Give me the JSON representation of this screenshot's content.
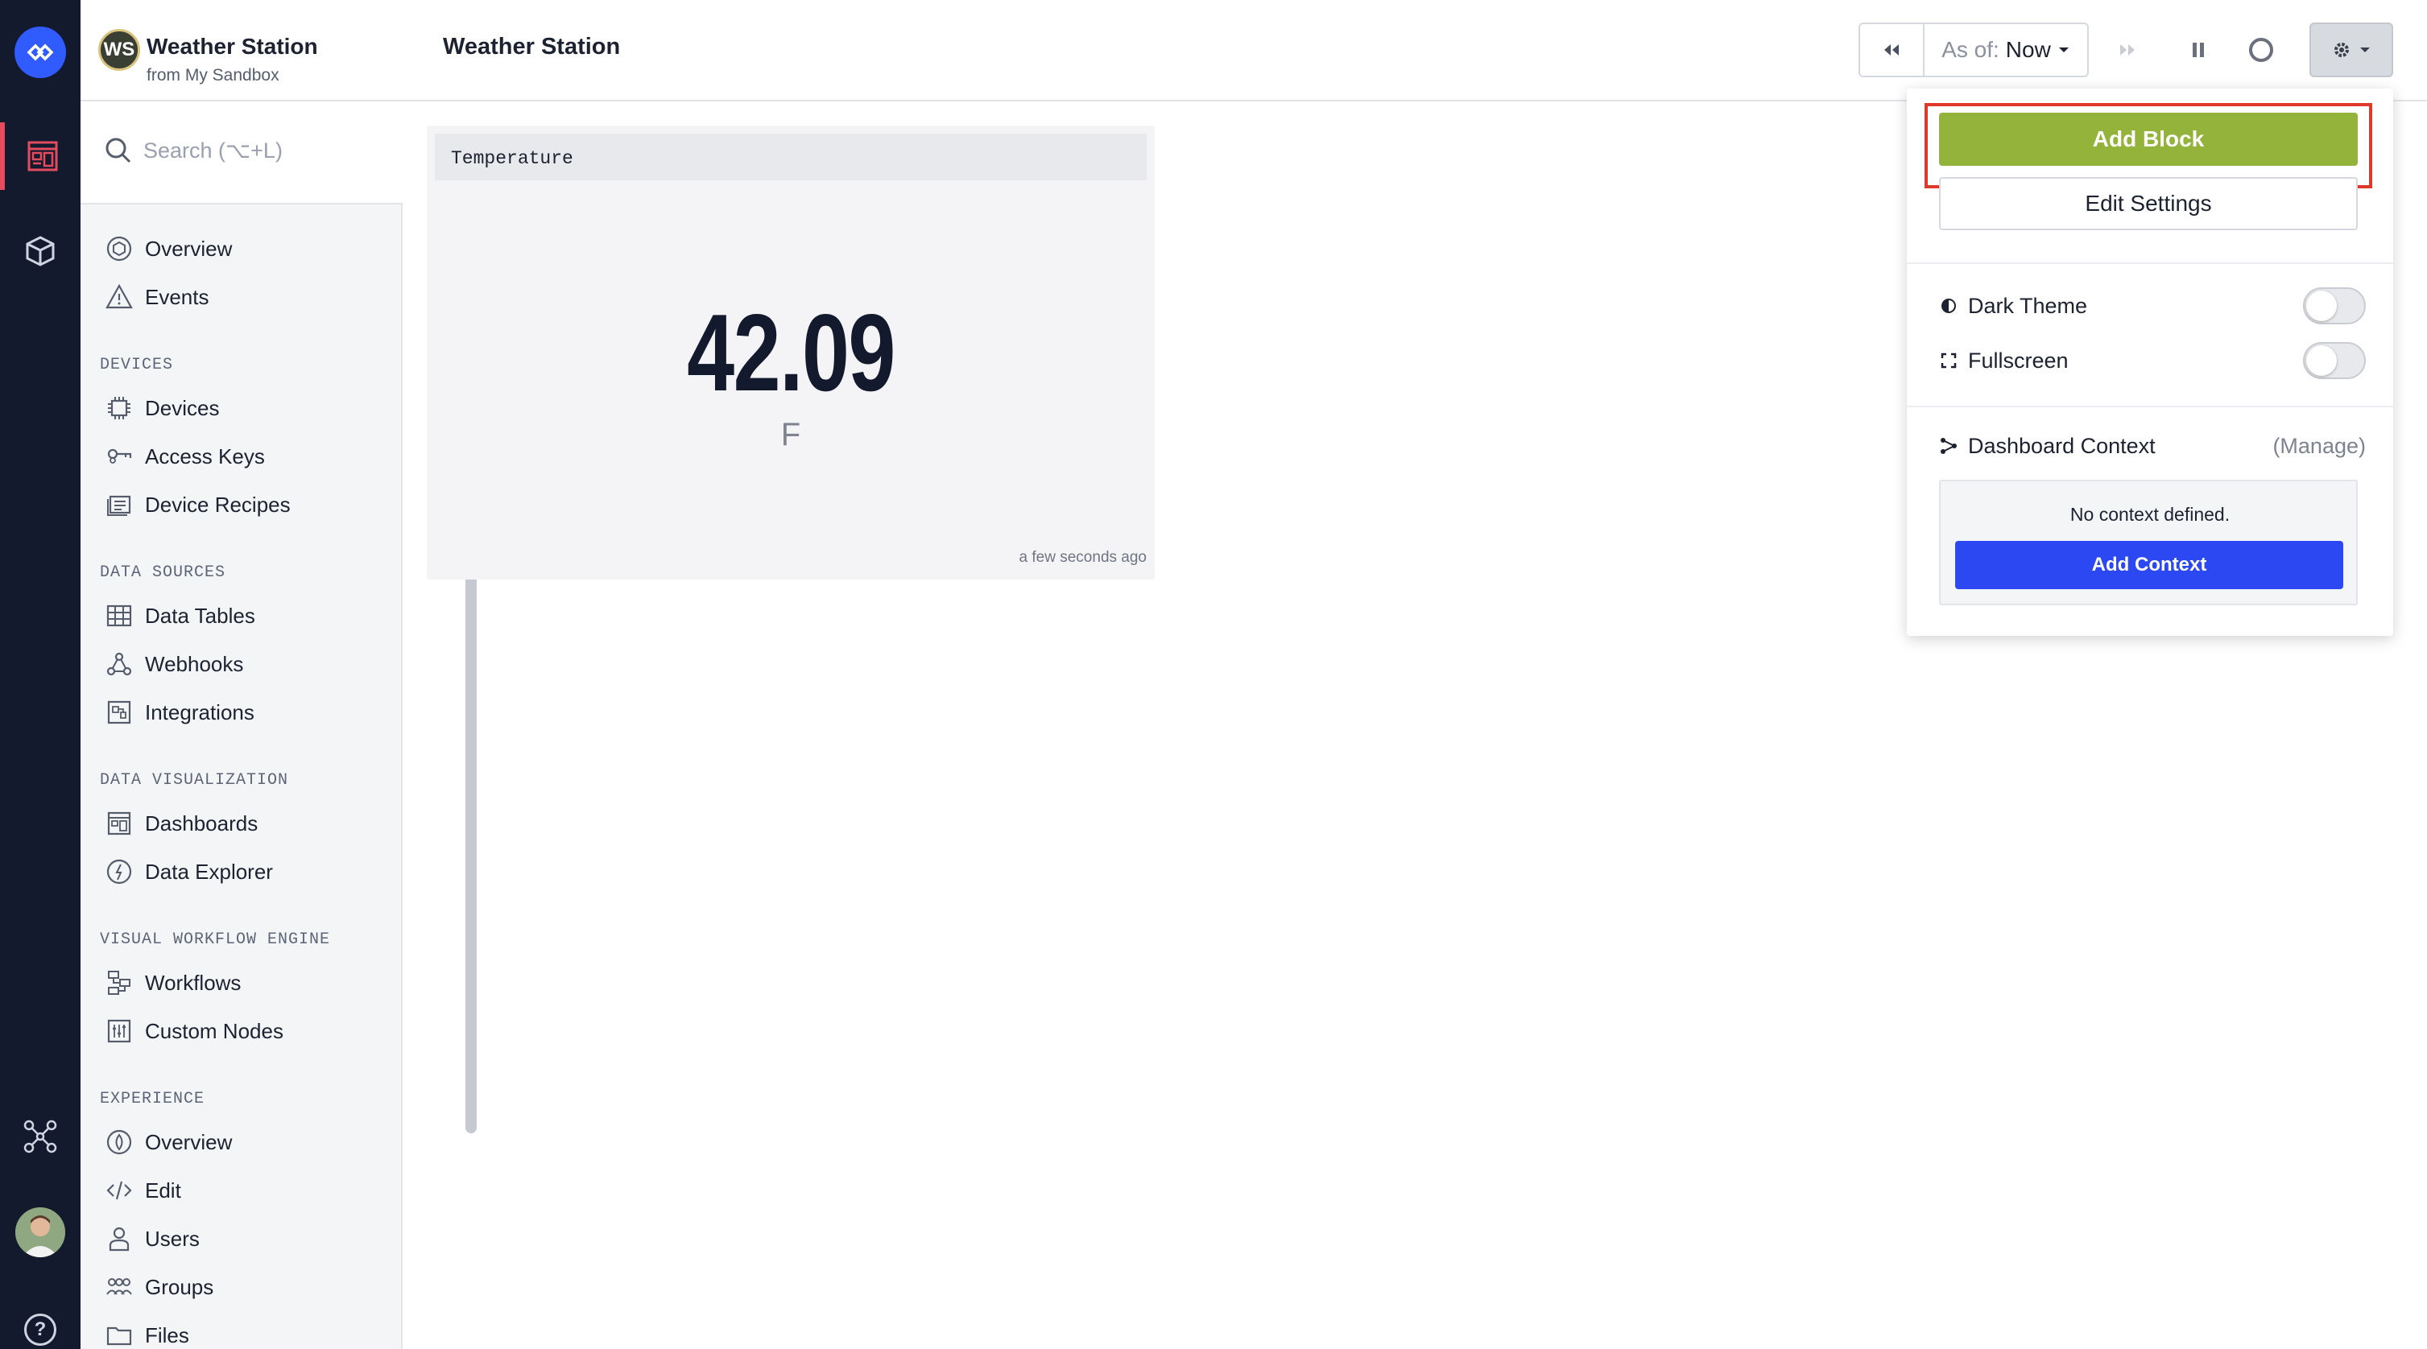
{
  "app": {
    "initials": "WS",
    "name": "Weather Station",
    "subtitle": "from My Sandbox"
  },
  "search": {
    "placeholder": "Search (⌥+L)"
  },
  "nav": {
    "overview": "Overview",
    "events": "Events",
    "section_devices": "DEVICES",
    "devices": "Devices",
    "access_keys": "Access Keys",
    "device_recipes": "Device Recipes",
    "section_data_sources": "DATA SOURCES",
    "data_tables": "Data Tables",
    "webhooks": "Webhooks",
    "integrations": "Integrations",
    "section_data_viz": "DATA VISUALIZATION",
    "dashboards": "Dashboards",
    "data_explorer": "Data Explorer",
    "section_workflow": "VISUAL WORKFLOW ENGINE",
    "workflows": "Workflows",
    "custom_nodes": "Custom Nodes",
    "section_experience": "EXPERIENCE",
    "exp_overview": "Overview",
    "edit": "Edit",
    "users": "Users",
    "groups": "Groups",
    "files": "Files"
  },
  "topbar": {
    "title": "Weather Station",
    "asof_prefix": "As of:",
    "asof_value": "Now"
  },
  "block": {
    "title": "Temperature",
    "value": "42.09",
    "unit": "F",
    "timestamp": "a few seconds ago"
  },
  "dropdown": {
    "add_block": "Add Block",
    "edit_settings": "Edit Settings",
    "dark_theme": "Dark Theme",
    "fullscreen": "Fullscreen",
    "dashboard_context": "Dashboard Context",
    "manage": "(Manage)",
    "no_context": "No context defined.",
    "add_context": "Add Context"
  },
  "colors": {
    "rail_bg": "#141a2e",
    "brand_blue": "#2f5bff",
    "add_block_green": "#93b33a",
    "add_context_blue": "#2b48f3",
    "highlight_red": "#e0392b",
    "active_red": "#e34b5e"
  },
  "icons": {
    "logo": "losant-logo-icon",
    "dashboard": "dashboard-icon",
    "cube": "cube-icon",
    "network": "network-icon",
    "help": "help-icon"
  }
}
